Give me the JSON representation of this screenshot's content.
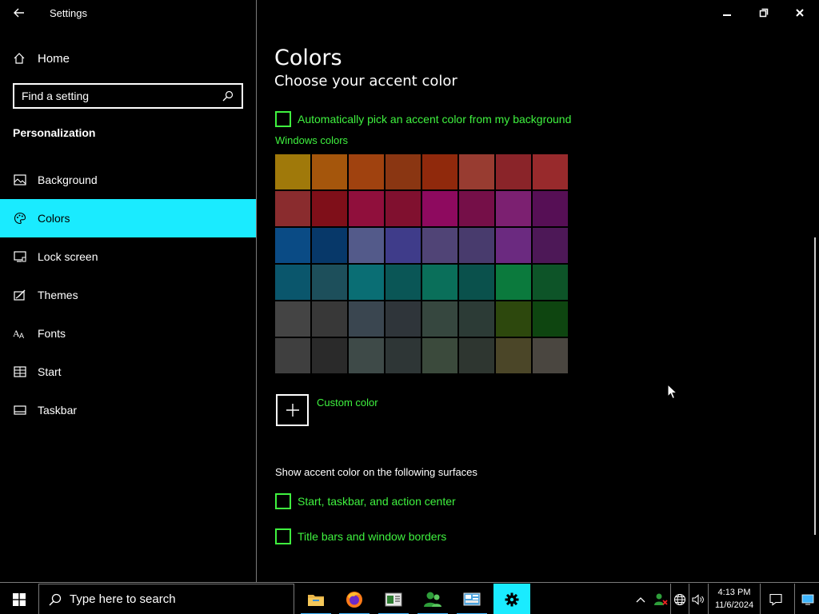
{
  "window": {
    "app_title": "Settings"
  },
  "sidebar": {
    "home_label": "Home",
    "search_placeholder": "Find a setting",
    "section_title": "Personalization",
    "items": [
      {
        "label": "Background",
        "icon": "image-icon"
      },
      {
        "label": "Colors",
        "icon": "palette-icon",
        "active": true
      },
      {
        "label": "Lock screen",
        "icon": "lock-screen-icon"
      },
      {
        "label": "Themes",
        "icon": "themes-icon"
      },
      {
        "label": "Fonts",
        "icon": "fonts-icon"
      },
      {
        "label": "Start",
        "icon": "start-icon"
      },
      {
        "label": "Taskbar",
        "icon": "taskbar-icon"
      }
    ]
  },
  "main": {
    "page_title": "Colors",
    "subtitle": "Choose your accent color",
    "auto_pick_label": "Automatically pick an accent color from my background",
    "windows_colors_label": "Windows colors",
    "custom_color_label": "Custom color",
    "surfaces_label": "Show accent color on the following surfaces",
    "surface_options": [
      "Start, taskbar, and action center",
      "Title bars and window borders"
    ],
    "swatches": [
      [
        "#a0790a",
        "#a5560c",
        "#a0420f",
        "#8a3612",
        "#90290c",
        "#983c31",
        "#8a2429",
        "#982a2c"
      ],
      [
        "#8a2c2e",
        "#7f0f19",
        "#900f3c",
        "#80102f",
        "#8e0a5f",
        "#750f48",
        "#7c2071",
        "#560f55"
      ],
      [
        "#0a4b85",
        "#073869",
        "#535a8a",
        "#3f3c8a",
        "#504476",
        "#483b6d",
        "#6b2a80",
        "#4d1857"
      ],
      [
        "#0a566c",
        "#1d4f5b",
        "#0a6e74",
        "#0a5656",
        "#0a6f5a",
        "#0a514c",
        "#0b7a3d",
        "#0d5428"
      ],
      [
        "#444444",
        "#383838",
        "#3a4650",
        "#2f353a",
        "#36473f",
        "#2c3b36",
        "#2d480d",
        "#0e4510"
      ],
      [
        "#3f3f3f",
        "#2a2a2a",
        "#3e4a48",
        "#2e3636",
        "#3b4a3c",
        "#2e3630",
        "#4b4628",
        "#4a4640"
      ]
    ]
  },
  "taskbar": {
    "search_placeholder": "Type here to search",
    "apps": [
      {
        "name": "file-explorer",
        "icon": "folder-icon"
      },
      {
        "name": "firefox",
        "icon": "firefox-icon"
      },
      {
        "name": "news-app",
        "icon": "news-icon"
      },
      {
        "name": "people-app",
        "icon": "people-icon"
      },
      {
        "name": "control-panel",
        "icon": "control-panel-icon"
      },
      {
        "name": "settings",
        "icon": "gear-icon",
        "active": true
      }
    ],
    "time": "4:13 PM",
    "date": "11/6/2024"
  },
  "colors": {
    "accent": "#1aebff",
    "green_text": "#3ff23f",
    "background": "#000000"
  }
}
